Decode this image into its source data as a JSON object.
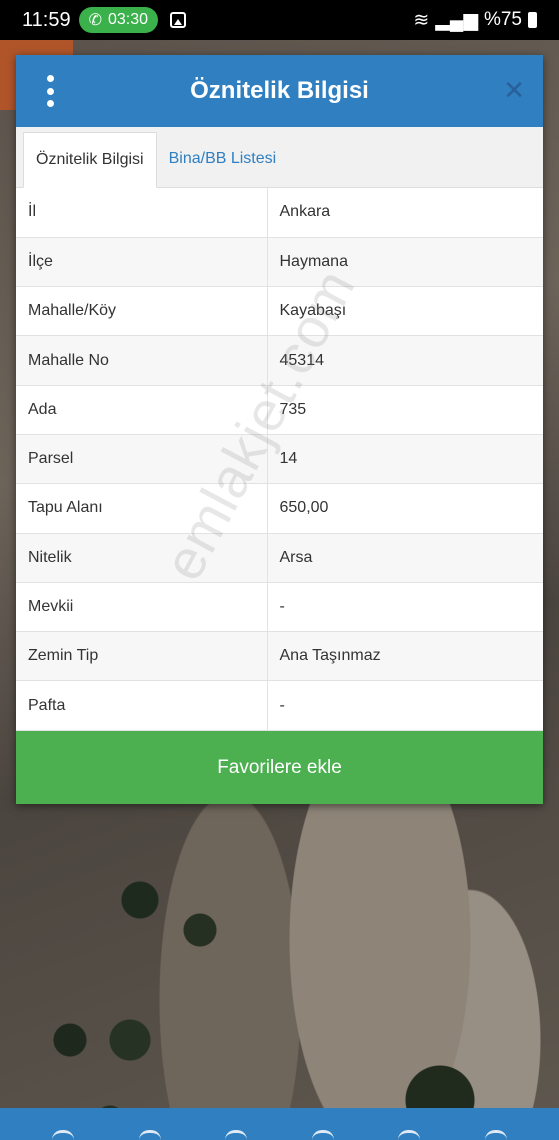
{
  "status_bar": {
    "time": "11:59",
    "call_time": "03:30",
    "battery": "%75"
  },
  "dialog": {
    "title": "Öznitelik Bilgisi",
    "tabs": [
      {
        "label": "Öznitelik Bilgisi",
        "active": true
      },
      {
        "label": "Bina/BB Listesi",
        "active": false
      }
    ],
    "rows": [
      {
        "key": "İl",
        "value": "Ankara"
      },
      {
        "key": "İlçe",
        "value": "Haymana"
      },
      {
        "key": "Mahalle/Köy",
        "value": "Kayabaşı"
      },
      {
        "key": "Mahalle No",
        "value": "45314"
      },
      {
        "key": "Ada",
        "value": "735"
      },
      {
        "key": "Parsel",
        "value": "14"
      },
      {
        "key": "Tapu Alanı",
        "value": "650,00"
      },
      {
        "key": "Nitelik",
        "value": "Arsa"
      },
      {
        "key": "Mevkii",
        "value": "-"
      },
      {
        "key": "Zemin Tip",
        "value": "Ana Taşınmaz"
      },
      {
        "key": "Pafta",
        "value": "-"
      }
    ],
    "favorite_button": "Favorilere ekle"
  },
  "watermark": "emlakjet.com",
  "colors": {
    "header": "#2f7fc1",
    "button": "#4caf50",
    "tab_link": "#2f7fc1"
  }
}
